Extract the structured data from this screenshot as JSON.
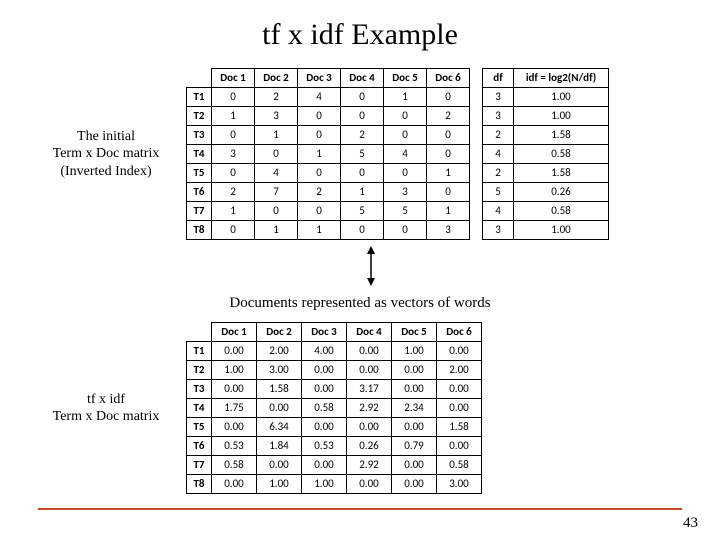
{
  "title": "tf x idf Example",
  "caption_top": "The initial\nTerm x Doc matrix\n(Inverted Index)",
  "caption_bottom": "tf x idf\nTerm x Doc matrix",
  "mid_label": "Documents represented as vectors of words",
  "page_number": "43",
  "chart_data": [
    {
      "type": "table",
      "title": "Initial Term x Doc matrix",
      "columns": [
        "Doc 1",
        "Doc 2",
        "Doc 3",
        "Doc 4",
        "Doc 5",
        "Doc 6"
      ],
      "rows": [
        "T1",
        "T2",
        "T3",
        "T4",
        "T5",
        "T6",
        "T7",
        "T8"
      ],
      "values": [
        [
          0,
          2,
          4,
          0,
          1,
          0
        ],
        [
          1,
          3,
          0,
          0,
          0,
          2
        ],
        [
          0,
          1,
          0,
          2,
          0,
          0
        ],
        [
          3,
          0,
          1,
          5,
          4,
          0
        ],
        [
          0,
          4,
          0,
          0,
          0,
          1
        ],
        [
          2,
          7,
          2,
          1,
          3,
          0
        ],
        [
          1,
          0,
          0,
          5,
          5,
          1
        ],
        [
          0,
          1,
          1,
          0,
          0,
          3
        ]
      ]
    },
    {
      "type": "table",
      "title": "df / idf",
      "columns": [
        "df",
        "idf = log2(N/df)"
      ],
      "rows": [
        "T1",
        "T2",
        "T3",
        "T4",
        "T5",
        "T6",
        "T7",
        "T8"
      ],
      "values": [
        [
          3,
          "1.00"
        ],
        [
          3,
          "1.00"
        ],
        [
          2,
          "1.58"
        ],
        [
          4,
          "0.58"
        ],
        [
          2,
          "1.58"
        ],
        [
          5,
          "0.26"
        ],
        [
          4,
          "0.58"
        ],
        [
          3,
          "1.00"
        ]
      ]
    },
    {
      "type": "table",
      "title": "tf x idf Term x Doc matrix",
      "columns": [
        "Doc 1",
        "Doc 2",
        "Doc 3",
        "Doc 4",
        "Doc 5",
        "Doc 6"
      ],
      "rows": [
        "T1",
        "T2",
        "T3",
        "T4",
        "T5",
        "T6",
        "T7",
        "T8"
      ],
      "values": [
        [
          "0.00",
          "2.00",
          "4.00",
          "0.00",
          "1.00",
          "0.00"
        ],
        [
          "1.00",
          "3.00",
          "0.00",
          "0.00",
          "0.00",
          "2.00"
        ],
        [
          "0.00",
          "1.58",
          "0.00",
          "3.17",
          "0.00",
          "0.00"
        ],
        [
          "1.75",
          "0.00",
          "0.58",
          "2.92",
          "2.34",
          "0.00"
        ],
        [
          "0.00",
          "6.34",
          "0.00",
          "0.00",
          "0.00",
          "1.58"
        ],
        [
          "0.53",
          "1.84",
          "0.53",
          "0.26",
          "0.79",
          "0.00"
        ],
        [
          "0.58",
          "0.00",
          "0.00",
          "2.92",
          "0.00",
          "0.58"
        ],
        [
          "0.00",
          "1.00",
          "1.00",
          "0.00",
          "0.00",
          "3.00"
        ]
      ]
    }
  ]
}
